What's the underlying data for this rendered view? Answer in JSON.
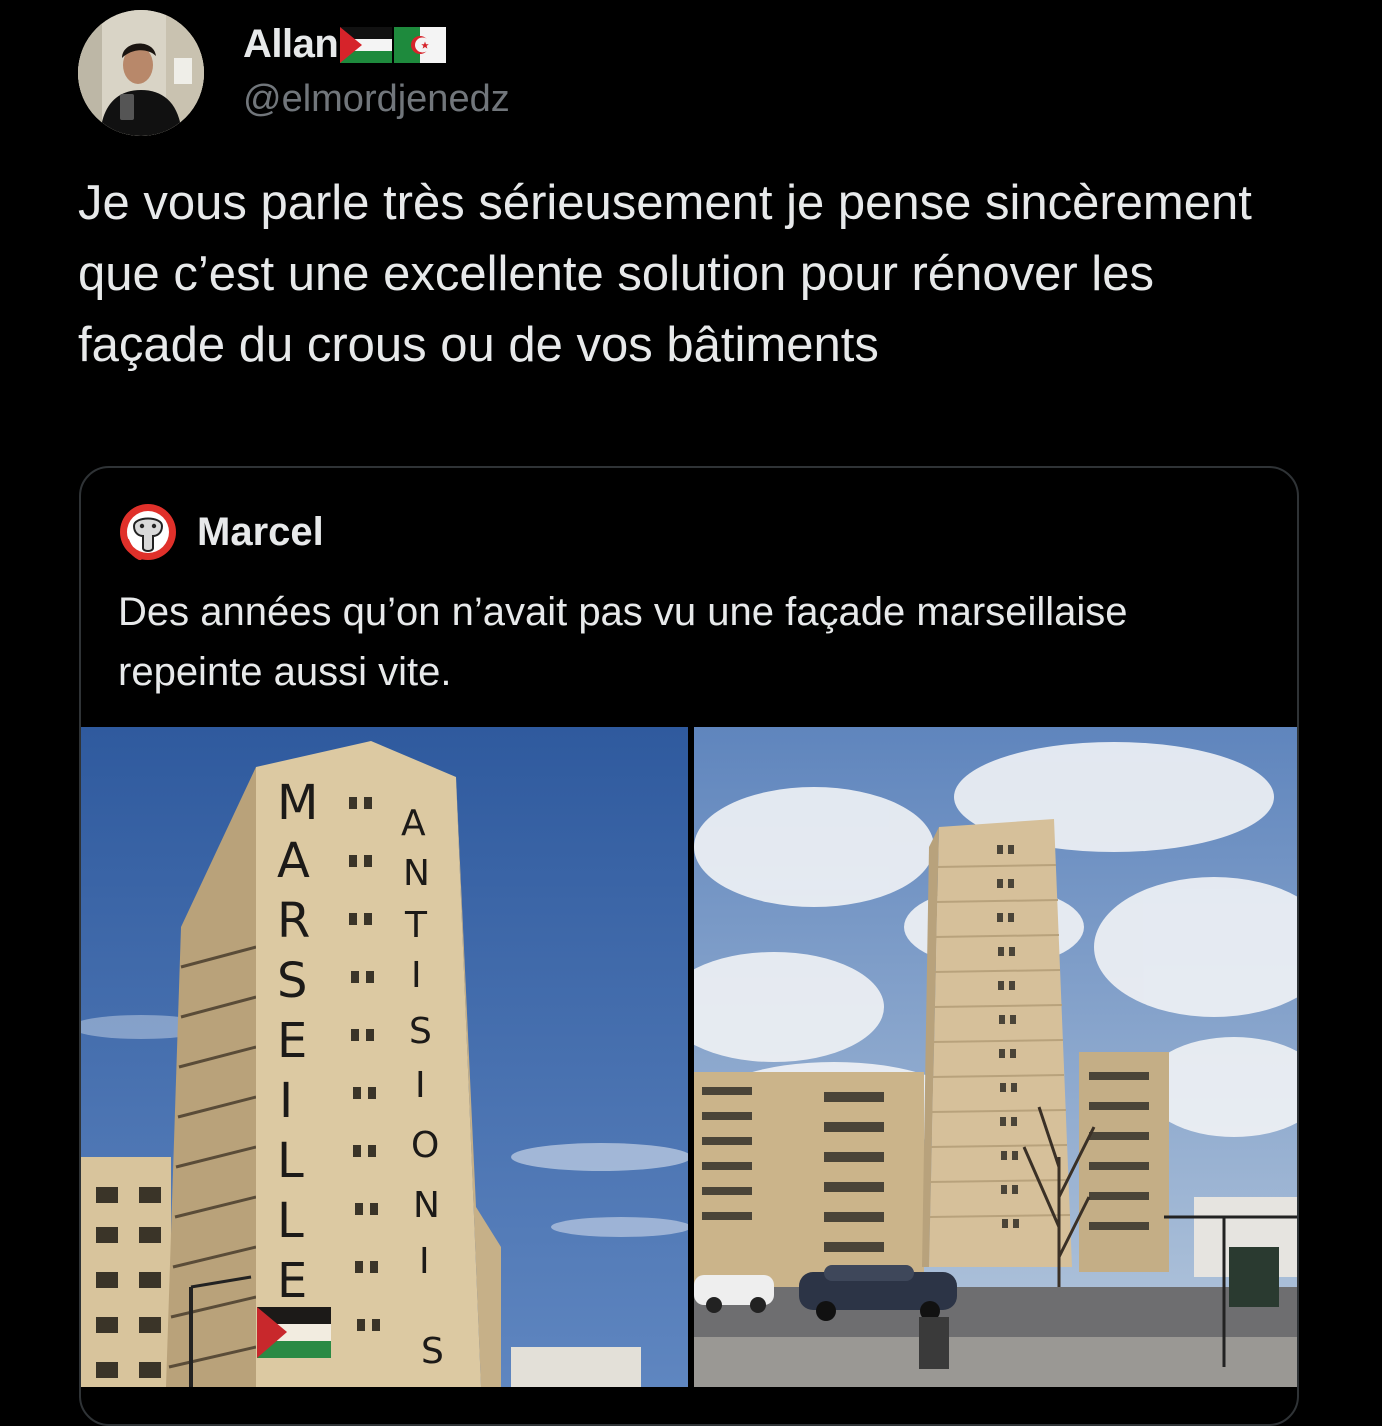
{
  "tweet": {
    "author": {
      "name": "Allan",
      "handle": "@elmordjenedz",
      "flags": [
        "palestine-flag-icon",
        "algeria-flag-icon"
      ]
    },
    "text": "Je vous parle très sérieusement je pense sincèrement que c’est une excellente solution pour rénover les façade du crous ou de vos bâtiments"
  },
  "quoted_tweet": {
    "author": {
      "name": "Marcel"
    },
    "text": "Des années qu’on n’avait pas vu une façade marseillaise repeinte aussi vite.",
    "images": [
      {
        "name": "tower-with-lettering-photo",
        "letters_left": [
          "M",
          "A",
          "R",
          "S",
          "E",
          "I",
          "L",
          "L",
          "E"
        ],
        "letters_right": [
          "A",
          "N",
          "T",
          "I",
          "S",
          "I",
          "O",
          "N",
          "I",
          "S"
        ]
      },
      {
        "name": "tower-repainted-photo"
      }
    ]
  },
  "colors": {
    "background": "#000000",
    "text_primary": "#e7e9ea",
    "text_secondary": "#71767b",
    "border": "#2f3336"
  }
}
